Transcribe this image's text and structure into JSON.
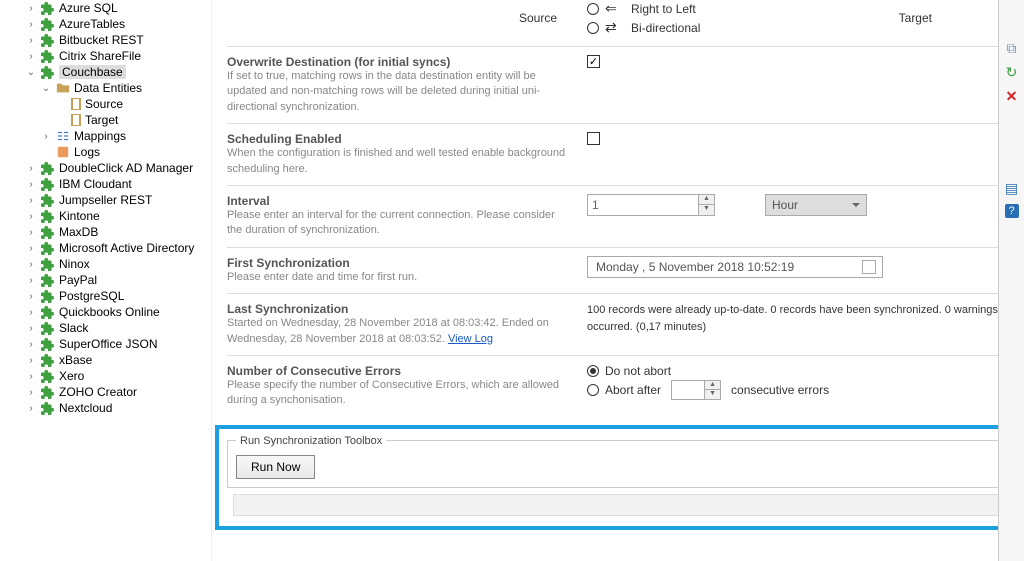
{
  "sidebar": {
    "items": [
      {
        "label": "Azure SQL",
        "indent": 0,
        "icon": "puzzle",
        "exp": "closed"
      },
      {
        "label": "AzureTables",
        "indent": 0,
        "icon": "puzzle",
        "exp": "closed"
      },
      {
        "label": "Bitbucket REST",
        "indent": 0,
        "icon": "puzzle",
        "exp": "closed"
      },
      {
        "label": "Citrix ShareFile",
        "indent": 0,
        "icon": "puzzle",
        "exp": "closed"
      },
      {
        "label": "Couchbase",
        "indent": 0,
        "icon": "puzzle",
        "exp": "open",
        "selected": true
      },
      {
        "label": "Data Entities",
        "indent": 1,
        "icon": "folder",
        "exp": "open"
      },
      {
        "label": "Source",
        "indent": 2,
        "icon": "doc",
        "exp": "blank"
      },
      {
        "label": "Target",
        "indent": 2,
        "icon": "doc",
        "exp": "blank"
      },
      {
        "label": "Mappings",
        "indent": 1,
        "icon": "map",
        "exp": "closed"
      },
      {
        "label": "Logs",
        "indent": 1,
        "icon": "log",
        "exp": "blank"
      },
      {
        "label": "DoubleClick  AD Manager",
        "indent": 0,
        "icon": "puzzle",
        "exp": "closed"
      },
      {
        "label": "IBM Cloudant",
        "indent": 0,
        "icon": "puzzle",
        "exp": "closed"
      },
      {
        "label": "Jumpseller REST",
        "indent": 0,
        "icon": "puzzle",
        "exp": "closed"
      },
      {
        "label": "Kintone",
        "indent": 0,
        "icon": "puzzle",
        "exp": "closed"
      },
      {
        "label": "MaxDB",
        "indent": 0,
        "icon": "puzzle",
        "exp": "closed"
      },
      {
        "label": "Microsoft Active Directory",
        "indent": 0,
        "icon": "puzzle",
        "exp": "closed"
      },
      {
        "label": "Ninox",
        "indent": 0,
        "icon": "puzzle",
        "exp": "closed"
      },
      {
        "label": "PayPal",
        "indent": 0,
        "icon": "puzzle",
        "exp": "closed"
      },
      {
        "label": "PostgreSQL",
        "indent": 0,
        "icon": "puzzle",
        "exp": "closed"
      },
      {
        "label": "Quickbooks Online",
        "indent": 0,
        "icon": "puzzle",
        "exp": "closed"
      },
      {
        "label": "Slack",
        "indent": 0,
        "icon": "puzzle",
        "exp": "closed"
      },
      {
        "label": "SuperOffice JSON",
        "indent": 0,
        "icon": "puzzle",
        "exp": "closed"
      },
      {
        "label": "xBase",
        "indent": 0,
        "icon": "puzzle",
        "exp": "closed"
      },
      {
        "label": "Xero",
        "indent": 0,
        "icon": "puzzle",
        "exp": "closed"
      },
      {
        "label": "ZOHO Creator",
        "indent": 0,
        "icon": "puzzle",
        "exp": "closed"
      },
      {
        "label": "Nextcloud",
        "indent": 0,
        "icon": "puzzle",
        "exp": "closed"
      }
    ]
  },
  "header": {
    "source": "Source",
    "target": "Target",
    "rtl": "Right to Left",
    "bi": "Bi-directional"
  },
  "sect": {
    "overwrite": {
      "title": "Overwrite Destination (for initial syncs)",
      "desc": "If set to true, matching rows in the data destination entity will be updated and non-matching rows will be deleted during initial uni-directional synchronization."
    },
    "sched": {
      "title": "Scheduling Enabled",
      "desc": "When the configuration is finished and well tested enable background scheduling here."
    },
    "interval": {
      "title": "Interval",
      "desc": "Please enter an interval for the current connection. Please consider the duration of synchronization.",
      "value": "1",
      "unit": "Hour"
    },
    "first": {
      "title": "First Synchronization",
      "desc": "Please enter date and time for first run.",
      "value": "Monday  ,   5 November 2018 10:52:19"
    },
    "last": {
      "title": "Last Synchronization",
      "desc": "Started  on Wednesday, 28 November 2018 at 08:03:42. Ended on Wednesday, 28 November 2018 at 08:03:52. ",
      "link": "View Log",
      "right": "100 records were already up-to-date. 0 records have been synchronized. 0 warnings occurred. (0,17 minutes)"
    },
    "errors": {
      "title": "Number of Consecutive Errors",
      "desc": "Please specify the number of Consecutive Errors, which are allowed during a synchonisation.",
      "opt1": "Do not abort",
      "opt2a": "Abort after",
      "opt2b": "consecutive errors"
    }
  },
  "toolbox": {
    "legend": "Run Synchronization Toolbox",
    "run": "Run Now"
  }
}
